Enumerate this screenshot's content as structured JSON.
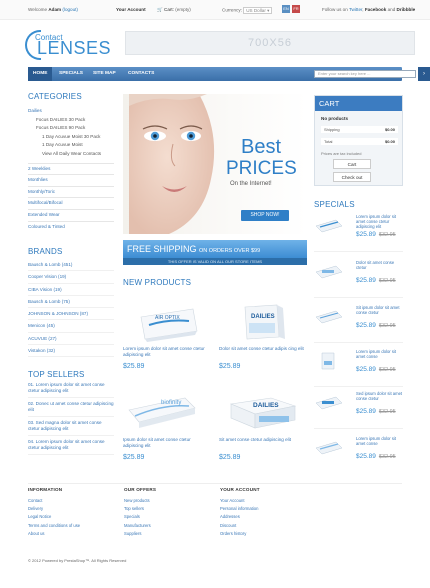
{
  "topbar": {
    "welcome": "Welcome",
    "user": "Adam",
    "logout": "(logout)",
    "account": "Your Account",
    "cart_label": "Cart:",
    "cart_value": "(empty)",
    "currency_label": "Currency:",
    "currency_value": "US Dollar",
    "lang1": "EN",
    "lang2": "FR",
    "follow": "Follow us on",
    "twitter": "Twitter",
    "facebook": "Facebook",
    "dribbble": "Dribbble",
    "and": "and",
    "comma": ","
  },
  "logo": {
    "line1": "Contact",
    "line2": "LENSES"
  },
  "banner": {
    "text": "700X56"
  },
  "nav": {
    "items": [
      "HOME",
      "SPECIALS",
      "SITE MAP",
      "CONTACTS"
    ],
    "search_placeholder": "Enter your search key here ..."
  },
  "categories": {
    "title": "CATEGORIES",
    "items": [
      {
        "label": "Dailies",
        "level": 0
      },
      {
        "label": "Focus DAILIES 30 Pack",
        "level": 1
      },
      {
        "label": "Focus DAILIES 90 Pack",
        "level": 1
      },
      {
        "label": "1 Day Acuvue Moist 30 Pack",
        "level": 2
      },
      {
        "label": "1 Day Acuvue Moist",
        "level": 2
      },
      {
        "label": "View All Daily Wear Contacts",
        "level": 2
      },
      {
        "label": "2 Weeklies",
        "level": 0
      },
      {
        "label": "Monthlies",
        "level": 0
      },
      {
        "label": "Monthly/Toric",
        "level": 0
      },
      {
        "label": "Multifocal/Bifocal",
        "level": 0
      },
      {
        "label": "Extended Wear",
        "level": 0
      },
      {
        "label": "Coloured & Tinted",
        "level": 0
      }
    ]
  },
  "brands": {
    "title": "BRANDS",
    "items": [
      "Bausch & Lomb (451)",
      "Cooper Vision (19)",
      "CIBA Vision (19)",
      "Bausch & Lomb (75)",
      "JOHNSON & JOHNSON (87)",
      "Menicon (45)",
      "ACUVUE (27)",
      "Vistakon (32)"
    ]
  },
  "top_sellers": {
    "title": "TOP SELLERS",
    "items": [
      {
        "num": "01.",
        "text": "Lorem ipsum dolor sit amet conse ctetur adipiscing elit"
      },
      {
        "num": "02.",
        "text": "Donec ut amet conse ctetur adipiscing elit"
      },
      {
        "num": "03.",
        "text": "Sed magna dolor sit amet conse ctetur adipiscing elit"
      },
      {
        "num": "04.",
        "text": "Lorem ipsum dolor sit amet conse ctetur adipiscing elit"
      }
    ]
  },
  "slider": {
    "best": "Best",
    "prices": "PRICES",
    "internet": "On the Internet!",
    "button": "SHOP NOW!"
  },
  "shipping": {
    "main": "FREE SHIPPING",
    "small": "ON ORDERS OVER $99",
    "sub": "THIS OFFER IS VALID ON ALL OUR STORE ITEMS"
  },
  "new_products": {
    "title": "NEW PRODUCTS",
    "items": [
      {
        "brand": "AIR OPTIX",
        "text": "Lorem ipsum dolor sit amet conse ctetur adipiscing elit",
        "price": "$25.89"
      },
      {
        "brand": "DAILIES",
        "text": "Dolor sit amet conse ctetur adipis cing elit",
        "price": "$25.89"
      },
      {
        "brand": "biofinity",
        "text": "Ipsum dolor sit amet conse ctetur adipiscing elit",
        "price": "$25.89"
      },
      {
        "brand": "DAILIES",
        "text": "Sit amet conse ctetur adipiscing elit",
        "price": "$25.89"
      }
    ]
  },
  "cart": {
    "title": "CART",
    "no_products": "No products",
    "shipping_label": "Shipping",
    "shipping_value": "$0.00",
    "total_label": "Total",
    "total_value": "$0.00",
    "note": "Prices are tax included",
    "cart_btn": "Cart",
    "checkout_btn": "Check out"
  },
  "specials": {
    "title": "SPECIALS",
    "items": [
      {
        "text": "Lorem ipsum dolor sit amet conse ctetur adipiscing elit",
        "price": "$25.89",
        "old": "$32.95"
      },
      {
        "text": "Dolor sit amet conse ctetur",
        "price": "$25.89",
        "old": "$32.95"
      },
      {
        "text": "Sit ipsum dolor sit amet conse ctetur",
        "price": "$25.89",
        "old": "$32.95"
      },
      {
        "text": "Lorem ipsum dolor sit amet conse",
        "price": "$25.89",
        "old": "$32.95"
      },
      {
        "text": "Sed ipsum dolor sit amet conse ctetur",
        "price": "$25.89",
        "old": "$32.95"
      },
      {
        "text": "Lorem ipsum dolor sit amet conse",
        "price": "$25.89",
        "old": "$32.95"
      }
    ]
  },
  "footer": {
    "columns": [
      {
        "title": "INFORMATION",
        "items": [
          "Contact",
          "Delivery",
          "Legal Notice",
          "Terms and conditions of use",
          "About us"
        ]
      },
      {
        "title": "OUR OFFERS",
        "items": [
          "New products",
          "Top sellers",
          "Specials",
          "Manufacturers",
          "Suppliers"
        ]
      },
      {
        "title": "YOUR ACCOUNT",
        "items": [
          "Your Account",
          "Personal information",
          "Addresses",
          "Discount",
          "Orders history"
        ]
      }
    ],
    "copyright": "© 2012 Powered by PrestaShop™. All Rights Reserved"
  },
  "colors": {
    "accent": "#3a8ed0",
    "nav": "#3a6fa8",
    "link": "#3a77b6"
  }
}
